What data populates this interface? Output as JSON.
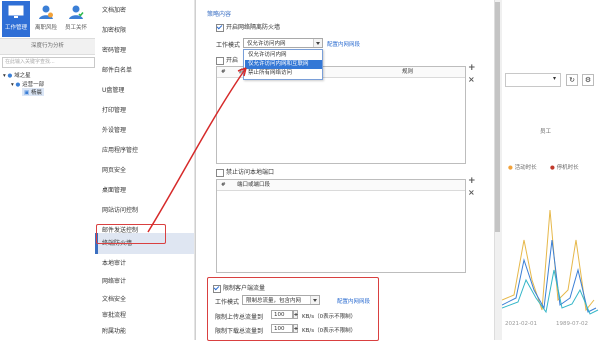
{
  "toolbar": {
    "buttons": [
      {
        "label": "工作管理",
        "active": true
      },
      {
        "label": "离职风险",
        "active": false
      },
      {
        "label": "员工关怀",
        "active": false
      }
    ],
    "subtitle": "深度行为分析"
  },
  "left_search": {
    "placeholder": "在此输入关键字查找..."
  },
  "tree": {
    "root": "域之星",
    "group": "运营一部",
    "node": "杨晨"
  },
  "menu": {
    "items": [
      "文档加密",
      "加密权限",
      "密码管理",
      "邮件白名单",
      "U盘管理",
      "打印管理",
      "外设管理",
      "应用程序管控",
      "网页安全",
      "桌面管理",
      "网站访问控制",
      "邮件发送控制",
      "终端防火墙",
      "本地审计",
      "网络审计",
      "文档安全",
      "审批流程",
      "附属功能"
    ],
    "selected_index": 12
  },
  "dialog": {
    "section_title": "策略内容",
    "enable_firewall": "开启网络隔离防火墙",
    "work_mode_label": "工作模式",
    "work_mode_value": "仅允许访问内网",
    "config_link": "配置内网网段",
    "open_label": "开启",
    "dropdown_options": [
      "仅允许访问内网",
      "仅允许访问内网和互联网",
      "禁止所有网络访问"
    ],
    "dropdown_highlight": 1,
    "table1": {
      "col_hash": "#",
      "col_enabled": "启",
      "col_rule": "规则"
    },
    "forbid_ports": "禁止访问本地端口",
    "table2": {
      "col_hash": "#",
      "col_port": "端口或端口段"
    },
    "limit_traffic": "限制客户端流量",
    "traffic_mode_label": "工作模式",
    "traffic_mode_value": "限制总流量，包含内网",
    "traffic_link": "配置内网网段",
    "upload_label": "限制上传总流量到",
    "upload_value": "100",
    "download_label": "限制下载总流量到",
    "download_value": "100",
    "unit_note": "KB/s（0表示不限制）"
  },
  "right_panel": {
    "legend_active": "活动时长",
    "legend_idle": "停机时长",
    "staff_label": "员工",
    "date_1": "2021-02-01",
    "date_2": "1989-07-02"
  },
  "colors": {
    "accent": "#2f6fd6",
    "arrow": "#d62a2a",
    "highlight_box": "#d94040"
  }
}
